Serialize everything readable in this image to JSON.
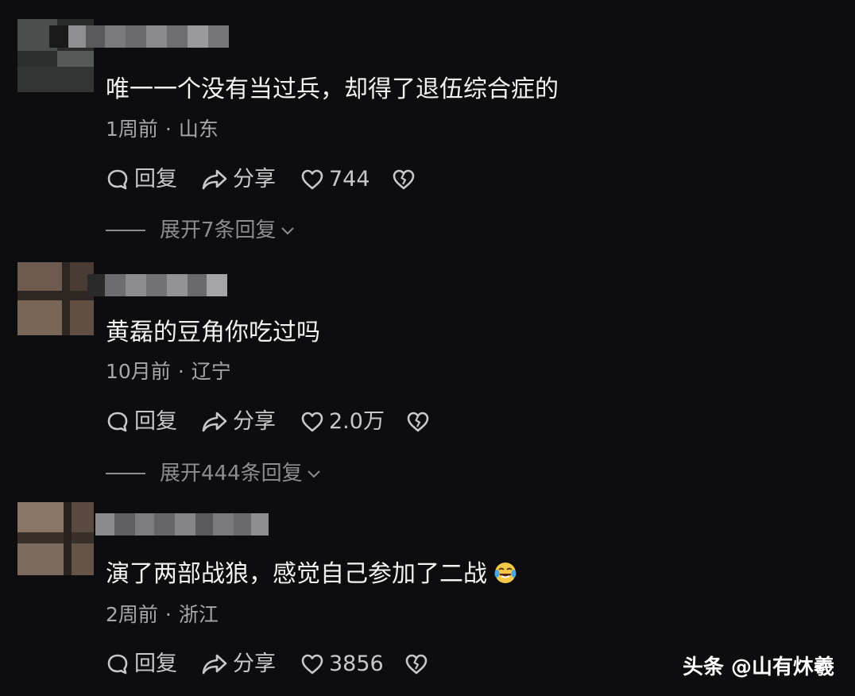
{
  "comments": [
    {
      "text": "唯一一个没有当过兵，却得了退伍综合症的",
      "time": "1周前",
      "location": "山东",
      "reply_label": "回复",
      "share_label": "分享",
      "likes": "744",
      "expand_label": "展开7条回复"
    },
    {
      "text": "黄磊的豆角你吃过吗",
      "time": "10月前",
      "location": "辽宁",
      "reply_label": "回复",
      "share_label": "分享",
      "likes": "2.0万",
      "expand_label": "展开444条回复"
    },
    {
      "text": "演了两部战狼，感觉自己参加了二战",
      "emoji": "laughing-crying-emoji",
      "time": "2周前",
      "location": "浙江",
      "reply_label": "回复",
      "share_label": "分享",
      "likes": "3856"
    }
  ],
  "meta_separator": "·",
  "watermark": "头条 @山有炑羲",
  "icons": {
    "reply": "speech-bubble-icon",
    "share": "share-arrow-icon",
    "like": "heart-icon",
    "dislike": "broken-heart-icon",
    "expand": "chevron-down-icon"
  },
  "colors": {
    "background": "#0d0c0e",
    "text": "#f2f2f2",
    "meta": "#a8a8ab",
    "action": "#c8c8cb",
    "expand": "#8d8d90"
  }
}
